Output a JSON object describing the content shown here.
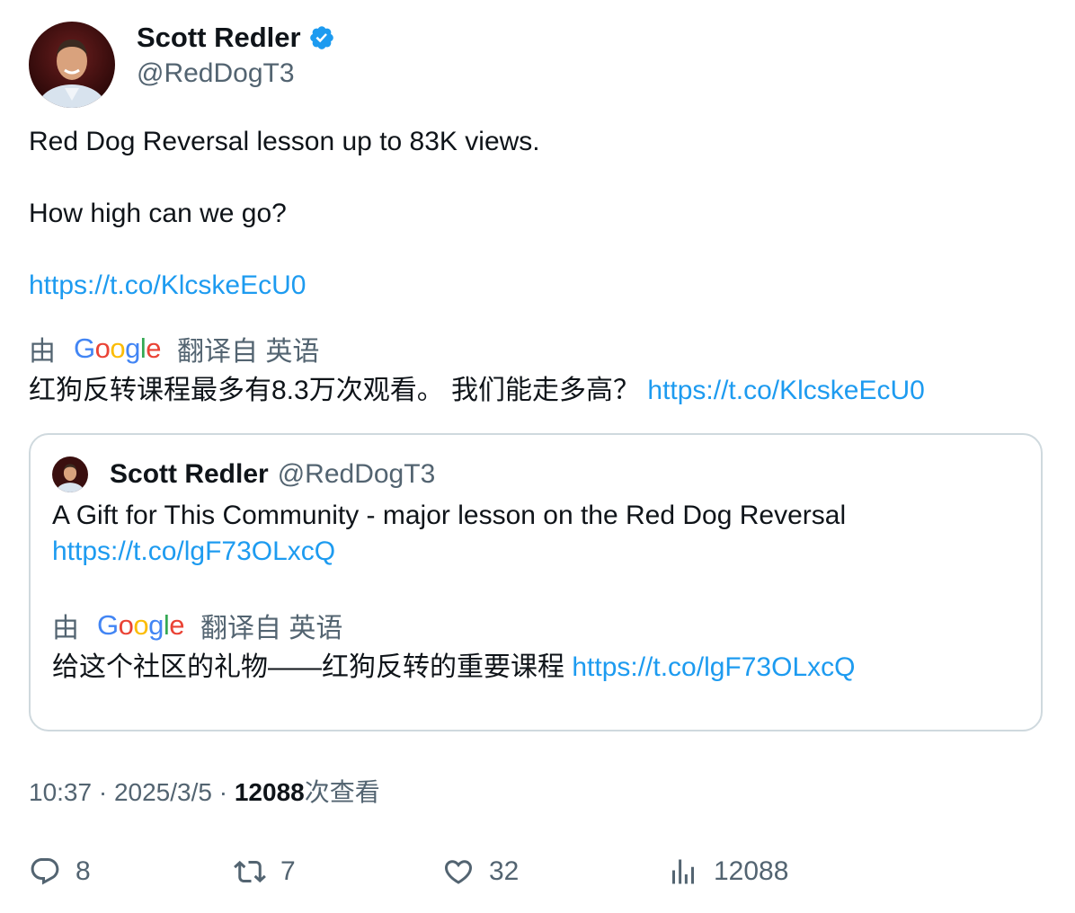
{
  "author": {
    "display_name": "Scott Redler",
    "handle": "@RedDogT3"
  },
  "tweet": {
    "text_line1": "Red Dog Reversal lesson up to 83K views.",
    "text_line2": "How high can we go?",
    "link": "https://t.co/KlcskeEcU0"
  },
  "translation": {
    "prefix": "由",
    "provider": "Google",
    "suffix": "翻译自 英语",
    "text": "红狗反转课程最多有8.3万次观看。 我们能走多高？",
    "link": "https://t.co/KlcskeEcU0"
  },
  "quoted_tweet": {
    "display_name": "Scott Redler",
    "handle": "@RedDogT3",
    "text": "A Gift for This Community - major lesson on the Red Dog Reversal",
    "link": "https://t.co/lgF73OLxcQ",
    "translation_prefix": "由",
    "translation_provider": "Google",
    "translation_suffix": "翻译自 英语",
    "translated_text": "给这个社区的礼物——红狗反转的重要课程",
    "translated_link": "https://t.co/lgF73OLxcQ"
  },
  "meta": {
    "time": "10:37",
    "separator": "·",
    "date": "2025/3/5",
    "views": "12088",
    "views_label": "次查看"
  },
  "actions": {
    "replies": "8",
    "reposts": "7",
    "likes": "32",
    "views": "12088"
  },
  "icons": {
    "verified": "verified-badge-icon",
    "reply": "reply-icon",
    "repost": "repost-icon",
    "like": "heart-icon",
    "views": "bar-chart-icon"
  },
  "colors": {
    "text": "#0f1419",
    "muted": "#536471",
    "link": "#1d9bf0",
    "verified": "#1d9bf0",
    "border": "#cfd9de"
  }
}
